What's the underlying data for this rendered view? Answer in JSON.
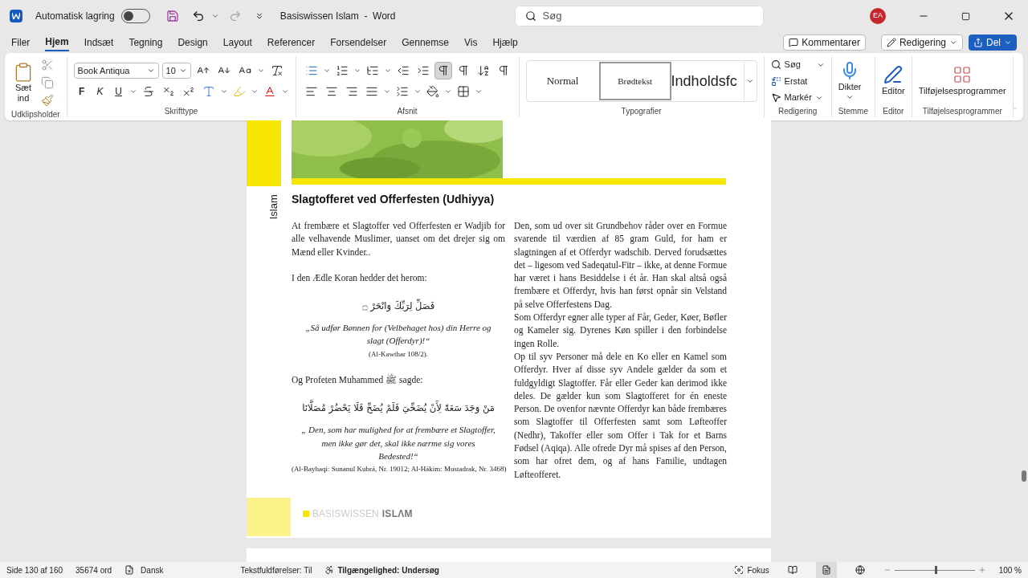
{
  "titlebar": {
    "autosave_label": "Automatisk lagring",
    "autosave_on": false,
    "doc_title": "Basiswissen Islam  -  Word",
    "search_placeholder": "Søg",
    "avatar": "EA"
  },
  "menu_tabs": [
    {
      "label": "Filer",
      "selected": false
    },
    {
      "label": "Hjem",
      "selected": true
    },
    {
      "label": "Indsæt",
      "selected": false
    },
    {
      "label": "Tegning",
      "selected": false
    },
    {
      "label": "Design",
      "selected": false
    },
    {
      "label": "Layout",
      "selected": false
    },
    {
      "label": "Referencer",
      "selected": false
    },
    {
      "label": "Forsendelser",
      "selected": false
    },
    {
      "label": "Gennemse",
      "selected": false
    },
    {
      "label": "Vis",
      "selected": false
    },
    {
      "label": "Hjælp",
      "selected": false
    }
  ],
  "header_buttons": {
    "comments": "Kommentarer",
    "editing": "Redigering",
    "share": "Del"
  },
  "ribbon": {
    "clipboard": {
      "paste": "Sæt ind",
      "group": "Udklipsholder"
    },
    "font": {
      "font_name": "Book Antiqua",
      "font_size": "10",
      "bold": "F",
      "italic": "K",
      "underline": "U",
      "group": "Skrifttype"
    },
    "paragraph": {
      "ltr_selected": true,
      "group": "Afsnit"
    },
    "styles": {
      "items": [
        {
          "label": "Normal",
          "selected": false
        },
        {
          "label": "Brødtekst",
          "selected": true
        },
        {
          "label": "Indholdsfc",
          "selected": false
        }
      ],
      "group": "Typografier"
    },
    "editing": {
      "find": "Søg",
      "replace": "Erstat",
      "select": "Markér",
      "group": "Redigering"
    },
    "voice": {
      "dictate": "Dikter",
      "group": "Stemme"
    },
    "editor": {
      "label": "Editor",
      "group": "Editor"
    },
    "addins": {
      "label": "Tilføjelsesprogrammer",
      "group": "Tilføjelsesprogrammer"
    }
  },
  "document": {
    "side_label": "Islam",
    "heading": "Slagtofferet ved Offerfesten (Udhiyya)",
    "left_column": [
      {
        "kind": "para",
        "text": "At frembære et Slagtoffer ved Offerfesten er Wadjib for alle velhavende Muslimer, uanset om det drejer sig om Mænd eller Kvinder.."
      },
      {
        "kind": "para",
        "text": "I den Ædle Koran hedder det herom:"
      },
      {
        "kind": "arabic",
        "text": "فَصَلِّ لِرَبِّكَ وَانْحَرْ ۝"
      },
      {
        "kind": "quote",
        "text": "„Så udfør Bønnen for (Velbehaget hos) din Herre og slagt (Offerdyr)!“"
      },
      {
        "kind": "source",
        "text": "(Al-Kawthar 108/2)."
      },
      {
        "kind": "para",
        "text": "Og Profeten Muhammed ﷺ sagde:"
      },
      {
        "kind": "arabic",
        "text": "مَنْ وَجَدَ سَعَةً لِأَنْ يُضَحِّيَ فَلَمْ يُضَحِّ فَلَا يَحْضُرْ مُصَلَّانَا"
      },
      {
        "kind": "quote",
        "text": "„ Den, som har mulighed for at frembære et Slagtoffer, men ikke gør det, skal ikke nærme sig vores Bedested!“"
      },
      {
        "kind": "source",
        "text": "(Al-Bayhaqi: Sunanul Kubrá, Nr. 19012; Al-Hákim: Mustadrak, Nr. 3468)"
      }
    ],
    "right_column": [
      "Den, som ud over sit Grundbehov råder over en Formue svarende til værdien af 85 gram Guld, for ham er slagtningen af et Offerdyr wadschib. Derved forudsættes det – ligesom ved Sadeqatul-Fitr – ikke, at denne Formue har været i hans Besiddelse i ét år. Han skal altså også frembære et Offerdyr, hvis han først opnår sin Velstand på selve Offerfestens Dag.",
      "Som Offerdyr egner alle typer af Får, Geder, Køer, Bøfler og Kameler sig. Dyrenes Køn spiller i den forbindelse ingen Rolle.",
      "Op til syv Personer må dele en Ko eller en Kamel som Offerdyr. Hver af disse syv Andele gælder da som et fuldgyldigt Slagtoffer. Får eller Geder kan derimod ikke deles. De gælder kun som Slagtofferet for én eneste Person. De ovenfor nævnte Offerdyr kan både frembæres som Slagtoffer til Offerfesten samt som Løfteoffer (Nedhr), Takoffer eller som Offer i Tak for et Barns Fødsel (Aqiqa). Alle ofrede Dyr må spises af den Person, som har ofret dem, og af hans Familie, undtagen Løfteofferet."
    ],
    "footer_logo": {
      "light": "BASISWISSEN",
      "bold": "ISLΛM"
    }
  },
  "status_bar": {
    "page": "Side 130 af 160",
    "words": "35674 ord",
    "language": "Dansk",
    "text_predictions": "Tekstfuldførelser: Til",
    "accessibility": "Tilgængelighed: Undersøg",
    "focus": "Fokus",
    "views": [
      {
        "kind": "read",
        "selected": false
      },
      {
        "kind": "print",
        "selected": true
      },
      {
        "kind": "web",
        "selected": false
      }
    ],
    "zoom": {
      "level": 0.5,
      "reading": "100 %"
    }
  }
}
